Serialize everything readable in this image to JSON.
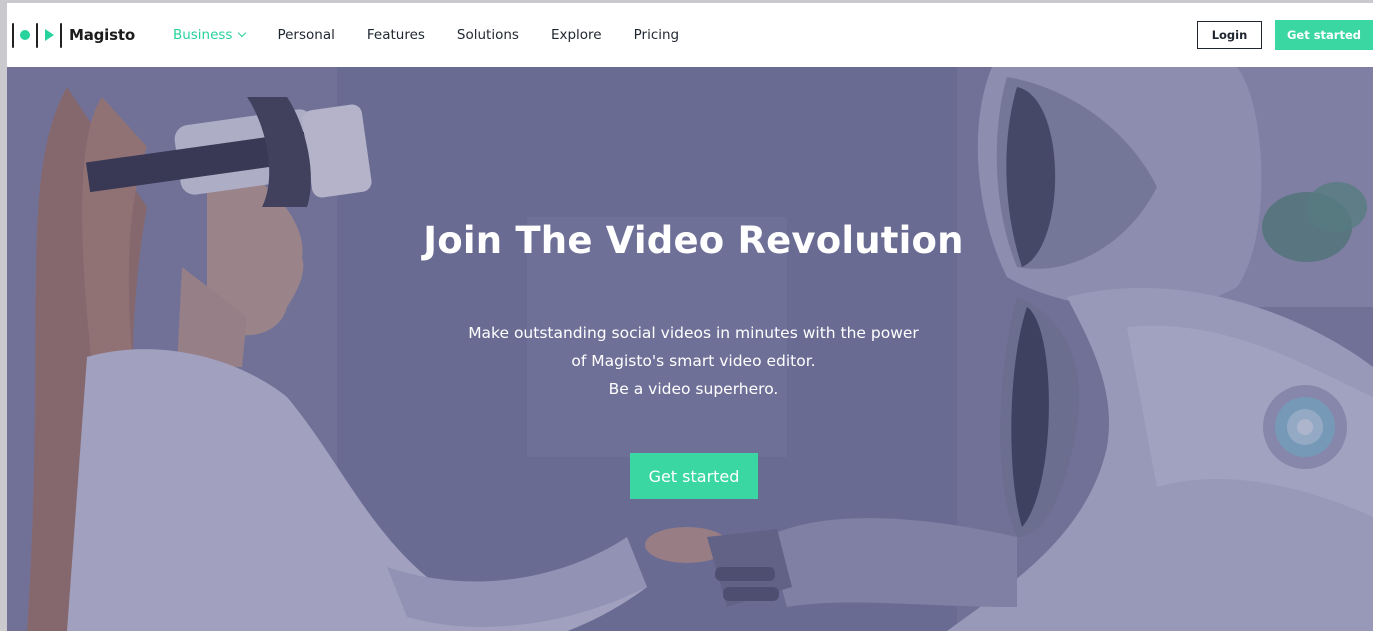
{
  "brand": {
    "name": "Magisto",
    "accent": "#3ad7a3"
  },
  "nav": {
    "items": [
      {
        "label": "Business",
        "active": true
      },
      {
        "label": "Personal"
      },
      {
        "label": "Features"
      },
      {
        "label": "Solutions"
      },
      {
        "label": "Explore"
      },
      {
        "label": "Pricing"
      }
    ],
    "login_label": "Login",
    "cta_label": "Get started"
  },
  "hero": {
    "title": "Join The Video Revolution",
    "subtitle_lines": [
      "Make outstanding social videos in minutes with the power",
      "of Magisto's smart video editor.",
      "Be a video superhero."
    ],
    "cta_label": "Get started",
    "background_description_icon": "vr-woman-robot-handshake-photo"
  },
  "colors": {
    "text_dark": "#1f2630",
    "overlay": "#4e4c80"
  }
}
